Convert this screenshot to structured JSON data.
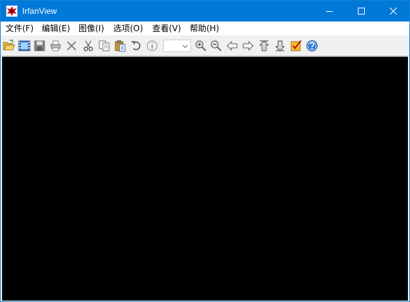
{
  "window": {
    "title": "IrfanView",
    "app_icon": "irfanview-icon"
  },
  "window_controls": {
    "minimize": "minimize-icon",
    "maximize": "maximize-icon",
    "close": "close-icon"
  },
  "menu": {
    "items": [
      {
        "label": "文件(F)"
      },
      {
        "label": "编辑(E)"
      },
      {
        "label": "图像(I)"
      },
      {
        "label": "选项(O)"
      },
      {
        "label": "查看(V)"
      },
      {
        "label": "帮助(H)"
      }
    ]
  },
  "toolbar": {
    "icons": [
      "open-folder-icon",
      "slideshow-icon",
      "save-icon",
      "print-icon",
      "delete-icon",
      "cut-icon",
      "copy-icon",
      "paste-icon",
      "undo-icon",
      "info-icon",
      "zoom-combo",
      "zoom-in-icon",
      "zoom-out-icon",
      "previous-arrow-icon",
      "next-arrow-icon",
      "first-file-icon",
      "last-file-icon",
      "settings-check-icon",
      "help-icon"
    ],
    "zoom_combo_value": ""
  },
  "colors": {
    "titlebar": "#0078d7",
    "canvas": "#000000",
    "toolbar": "#f0f0f0",
    "menubar": "#ffffff"
  }
}
